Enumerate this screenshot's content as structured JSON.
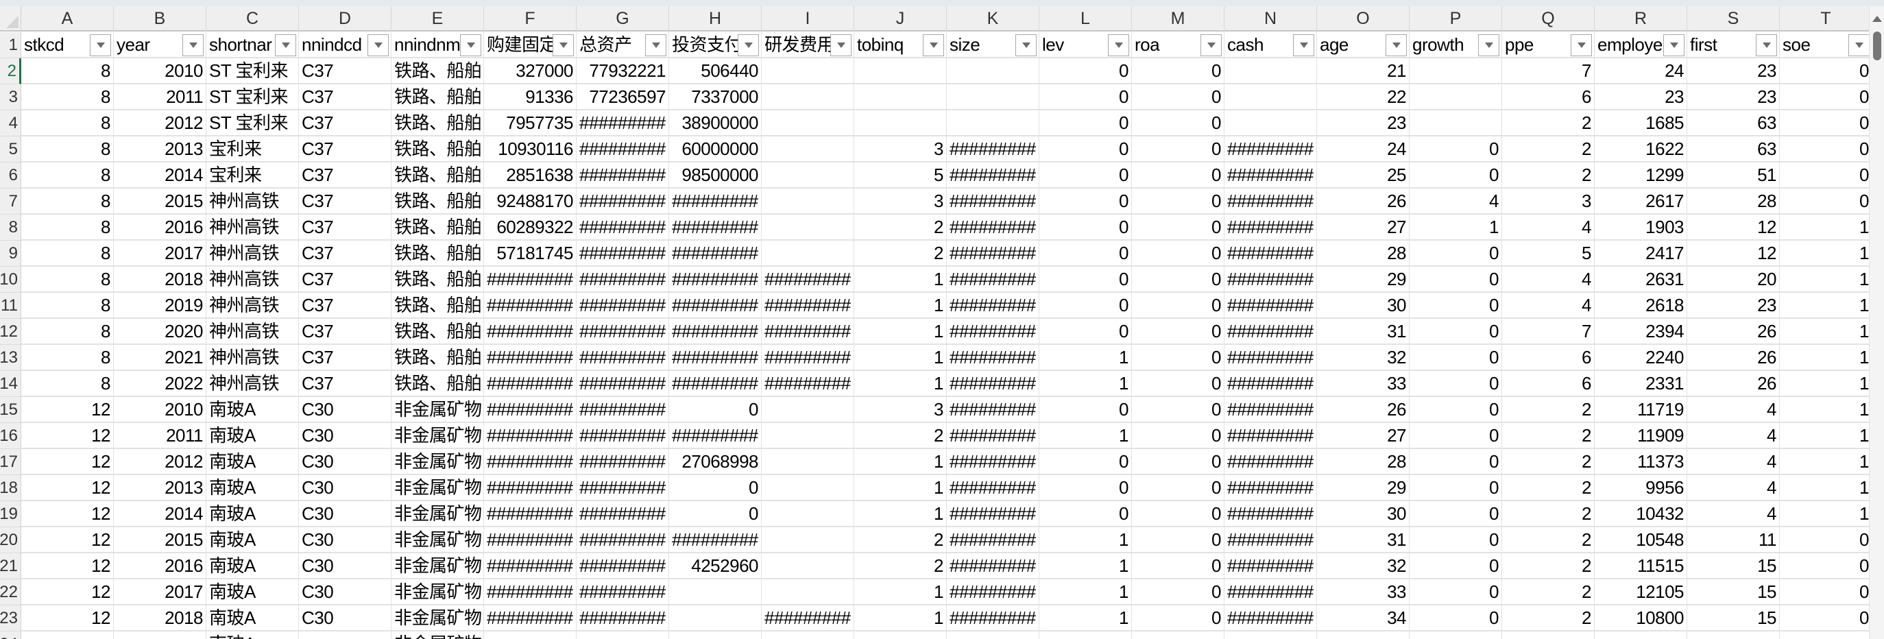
{
  "column_letters": [
    "A",
    "B",
    "C",
    "D",
    "E",
    "F",
    "G",
    "H",
    "I",
    "J",
    "K",
    "L",
    "M",
    "N",
    "O",
    "P",
    "Q",
    "R",
    "S",
    "T"
  ],
  "headers": [
    "stkcd",
    "year",
    "shortnar",
    "nnindcd",
    "nnindnm",
    "购建固定",
    "总资产",
    "投资支付",
    "研发费用",
    "tobinq",
    "size",
    "lev",
    "roa",
    "cash",
    "age",
    "growth",
    "ppe",
    "employe",
    "first",
    "soe"
  ],
  "header_row_number": "1",
  "active_row": "2",
  "rows": [
    {
      "n": "2",
      "cells": [
        "8",
        "2010",
        "ST 宝利来",
        "C37",
        "铁路、船舶",
        "327000",
        "77932221",
        "506440",
        "",
        "",
        "",
        "0",
        "0",
        "",
        "21",
        "",
        "7",
        "24",
        "23",
        "0"
      ]
    },
    {
      "n": "3",
      "cells": [
        "8",
        "2011",
        "ST 宝利来",
        "C37",
        "铁路、船舶",
        "91336",
        "77236597",
        "7337000",
        "",
        "",
        "",
        "0",
        "0",
        "",
        "22",
        "",
        "6",
        "23",
        "23",
        "0"
      ]
    },
    {
      "n": "4",
      "cells": [
        "8",
        "2012",
        "ST 宝利来",
        "C37",
        "铁路、船舶",
        "7957735",
        "#########",
        "38900000",
        "",
        "",
        "",
        "0",
        "0",
        "",
        "23",
        "",
        "2",
        "1685",
        "63",
        "0"
      ]
    },
    {
      "n": "5",
      "cells": [
        "8",
        "2013",
        "宝利来",
        "C37",
        "铁路、船舶",
        "10930116",
        "#########",
        "60000000",
        "",
        "3",
        "#########",
        "0",
        "0",
        "#########",
        "24",
        "0",
        "2",
        "1622",
        "63",
        "0"
      ]
    },
    {
      "n": "6",
      "cells": [
        "8",
        "2014",
        "宝利来",
        "C37",
        "铁路、船舶",
        "2851638",
        "#########",
        "98500000",
        "",
        "5",
        "#########",
        "0",
        "0",
        "#########",
        "25",
        "0",
        "2",
        "1299",
        "51",
        "0"
      ]
    },
    {
      "n": "7",
      "cells": [
        "8",
        "2015",
        "神州高铁",
        "C37",
        "铁路、船舶",
        "92488170",
        "#########",
        "#########",
        "",
        "3",
        "#########",
        "0",
        "0",
        "#########",
        "26",
        "4",
        "3",
        "2617",
        "28",
        "0"
      ]
    },
    {
      "n": "8",
      "cells": [
        "8",
        "2016",
        "神州高铁",
        "C37",
        "铁路、船舶",
        "60289322",
        "#########",
        "#########",
        "",
        "2",
        "#########",
        "0",
        "0",
        "#########",
        "27",
        "1",
        "4",
        "1903",
        "12",
        "1"
      ]
    },
    {
      "n": "9",
      "cells": [
        "8",
        "2017",
        "神州高铁",
        "C37",
        "铁路、船舶",
        "57181745",
        "#########",
        "#########",
        "",
        "2",
        "#########",
        "0",
        "0",
        "#########",
        "28",
        "0",
        "5",
        "2417",
        "12",
        "1"
      ]
    },
    {
      "n": "10",
      "cells": [
        "8",
        "2018",
        "神州高铁",
        "C37",
        "铁路、船舶",
        "#########",
        "#########",
        "#########",
        "#########",
        "1",
        "#########",
        "0",
        "0",
        "#########",
        "29",
        "0",
        "4",
        "2631",
        "20",
        "1"
      ]
    },
    {
      "n": "11",
      "cells": [
        "8",
        "2019",
        "神州高铁",
        "C37",
        "铁路、船舶",
        "#########",
        "#########",
        "#########",
        "#########",
        "1",
        "#########",
        "0",
        "0",
        "#########",
        "30",
        "0",
        "4",
        "2618",
        "23",
        "1"
      ]
    },
    {
      "n": "12",
      "cells": [
        "8",
        "2020",
        "神州高铁",
        "C37",
        "铁路、船舶",
        "#########",
        "#########",
        "#########",
        "#########",
        "1",
        "#########",
        "0",
        "0",
        "#########",
        "31",
        "0",
        "7",
        "2394",
        "26",
        "1"
      ]
    },
    {
      "n": "13",
      "cells": [
        "8",
        "2021",
        "神州高铁",
        "C37",
        "铁路、船舶",
        "#########",
        "#########",
        "#########",
        "#########",
        "1",
        "#########",
        "1",
        "0",
        "#########",
        "32",
        "0",
        "6",
        "2240",
        "26",
        "1"
      ]
    },
    {
      "n": "14",
      "cells": [
        "8",
        "2022",
        "神州高铁",
        "C37",
        "铁路、船舶",
        "#########",
        "#########",
        "#########",
        "#########",
        "1",
        "#########",
        "1",
        "0",
        "#########",
        "33",
        "0",
        "6",
        "2331",
        "26",
        "1"
      ]
    },
    {
      "n": "15",
      "cells": [
        "12",
        "2010",
        "南玻A",
        "C30",
        "非金属矿物",
        "#########",
        "#########",
        "0",
        "",
        "3",
        "#########",
        "0",
        "0",
        "#########",
        "26",
        "0",
        "2",
        "11719",
        "4",
        "1"
      ]
    },
    {
      "n": "16",
      "cells": [
        "12",
        "2011",
        "南玻A",
        "C30",
        "非金属矿物",
        "#########",
        "#########",
        "#########",
        "",
        "2",
        "#########",
        "1",
        "0",
        "#########",
        "27",
        "0",
        "2",
        "11909",
        "4",
        "1"
      ]
    },
    {
      "n": "17",
      "cells": [
        "12",
        "2012",
        "南玻A",
        "C30",
        "非金属矿物",
        "#########",
        "#########",
        "27068998",
        "",
        "1",
        "#########",
        "0",
        "0",
        "#########",
        "28",
        "0",
        "2",
        "11373",
        "4",
        "1"
      ]
    },
    {
      "n": "18",
      "cells": [
        "12",
        "2013",
        "南玻A",
        "C30",
        "非金属矿物",
        "#########",
        "#########",
        "0",
        "",
        "1",
        "#########",
        "0",
        "0",
        "#########",
        "29",
        "0",
        "2",
        "9956",
        "4",
        "1"
      ]
    },
    {
      "n": "19",
      "cells": [
        "12",
        "2014",
        "南玻A",
        "C30",
        "非金属矿物",
        "#########",
        "#########",
        "0",
        "",
        "1",
        "#########",
        "0",
        "0",
        "#########",
        "30",
        "0",
        "2",
        "10432",
        "4",
        "1"
      ]
    },
    {
      "n": "20",
      "cells": [
        "12",
        "2015",
        "南玻A",
        "C30",
        "非金属矿物",
        "#########",
        "#########",
        "#########",
        "",
        "2",
        "#########",
        "1",
        "0",
        "#########",
        "31",
        "0",
        "2",
        "10548",
        "11",
        "0"
      ]
    },
    {
      "n": "21",
      "cells": [
        "12",
        "2016",
        "南玻A",
        "C30",
        "非金属矿物",
        "#########",
        "#########",
        "4252960",
        "",
        "2",
        "#########",
        "1",
        "0",
        "#########",
        "32",
        "0",
        "2",
        "11515",
        "15",
        "0"
      ]
    },
    {
      "n": "22",
      "cells": [
        "12",
        "2017",
        "南玻A",
        "C30",
        "非金属矿物",
        "#########",
        "#########",
        "",
        "",
        "1",
        "#########",
        "1",
        "0",
        "#########",
        "33",
        "0",
        "2",
        "12105",
        "15",
        "0"
      ]
    },
    {
      "n": "23",
      "cells": [
        "12",
        "2018",
        "南玻A",
        "C30",
        "非金属矿物",
        "#########",
        "#########",
        "",
        "#########",
        "1",
        "#########",
        "1",
        "0",
        "#########",
        "34",
        "0",
        "2",
        "10800",
        "15",
        "0"
      ]
    },
    {
      "n": "24",
      "cells": [
        "",
        "",
        "南玻A",
        "",
        "非金属矿物",
        "",
        "",
        "",
        "",
        "",
        "",
        "",
        "",
        "",
        "",
        "",
        "",
        "",
        "",
        ""
      ]
    }
  ]
}
